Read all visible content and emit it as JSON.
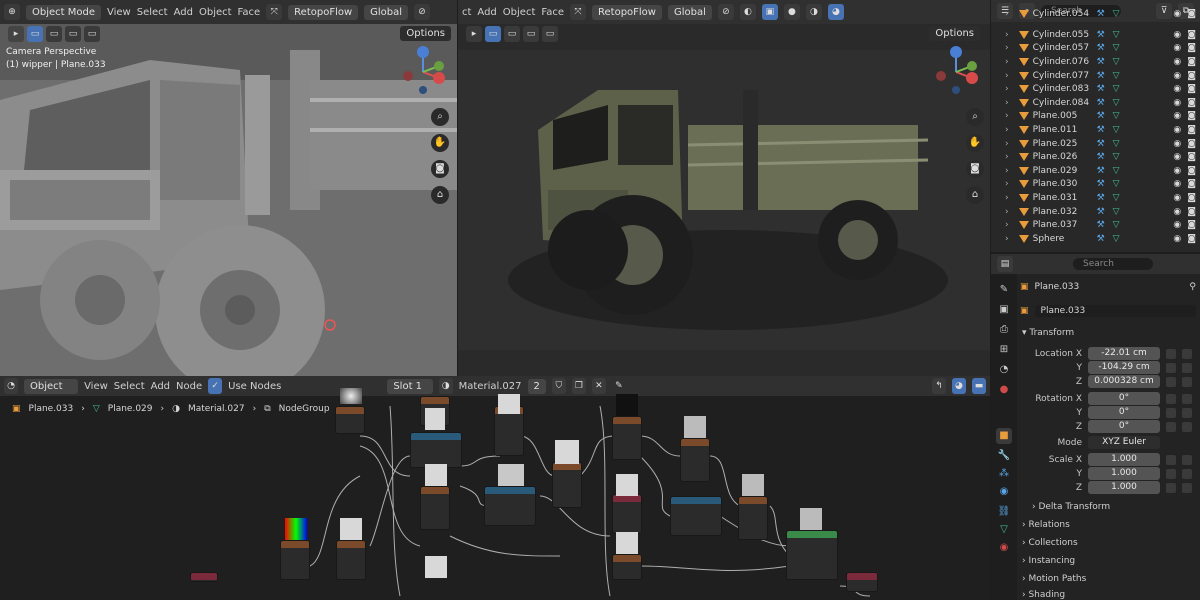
{
  "viewport_left": {
    "mode_label": "Object Mode",
    "menus": [
      "View",
      "Select",
      "Add",
      "Object",
      "Face"
    ],
    "addon": "RetopoFlow",
    "transform": "Global",
    "options_label": "Options",
    "camera_info": "Camera Perspective",
    "object_info": "(1) wipper | Plane.033"
  },
  "viewport_right": {
    "menus": [
      "ct",
      "Add",
      "Object",
      "Face"
    ],
    "addon": "RetopoFlow",
    "transform": "Global",
    "options_label": "Options"
  },
  "node_editor": {
    "editor_mode": "Object",
    "menus": [
      "View",
      "Select",
      "Add",
      "Node"
    ],
    "use_nodes_label": "Use Nodes",
    "slot": "Slot 1",
    "material": "Material.027",
    "users": "2",
    "breadcrumbs": [
      "Plane.033",
      "Plane.029",
      "Material.027",
      "NodeGroup"
    ]
  },
  "outliner": {
    "search_placeholder": "Search",
    "items": [
      "Cylinder.054",
      "Cylinder.055",
      "Cylinder.057",
      "Cylinder.076",
      "Cylinder.077",
      "Cylinder.083",
      "Cylinder.084",
      "Plane.005",
      "Plane.011",
      "Plane.025",
      "Plane.026",
      "Plane.029",
      "Plane.030",
      "Plane.031",
      "Plane.032",
      "Plane.037",
      "Sphere"
    ]
  },
  "properties": {
    "search_placeholder": "Search",
    "object_name": "Plane.033",
    "data_name": "Plane.033",
    "transform_label": "Transform",
    "location_labels": [
      "Location X",
      "Y",
      "Z"
    ],
    "location_values": [
      "-22.01 cm",
      "-104.29 cm",
      "0.000328 cm"
    ],
    "rotation_labels": [
      "Rotation X",
      "Y",
      "Z"
    ],
    "rotation_values": [
      "0°",
      "0°",
      "0°"
    ],
    "mode_label": "Mode",
    "mode_value": "XYZ Euler",
    "scale_labels": [
      "Scale X",
      "Y",
      "Z"
    ],
    "scale_values": [
      "1.000",
      "1.000",
      "1.000"
    ],
    "sections": [
      "Delta Transform",
      "Relations",
      "Collections",
      "Instancing",
      "Motion Paths",
      "Shading"
    ]
  },
  "colors": {
    "accent": "#4772b3",
    "selected_outline": "#e87f2b",
    "background": "#1d1d1d"
  }
}
